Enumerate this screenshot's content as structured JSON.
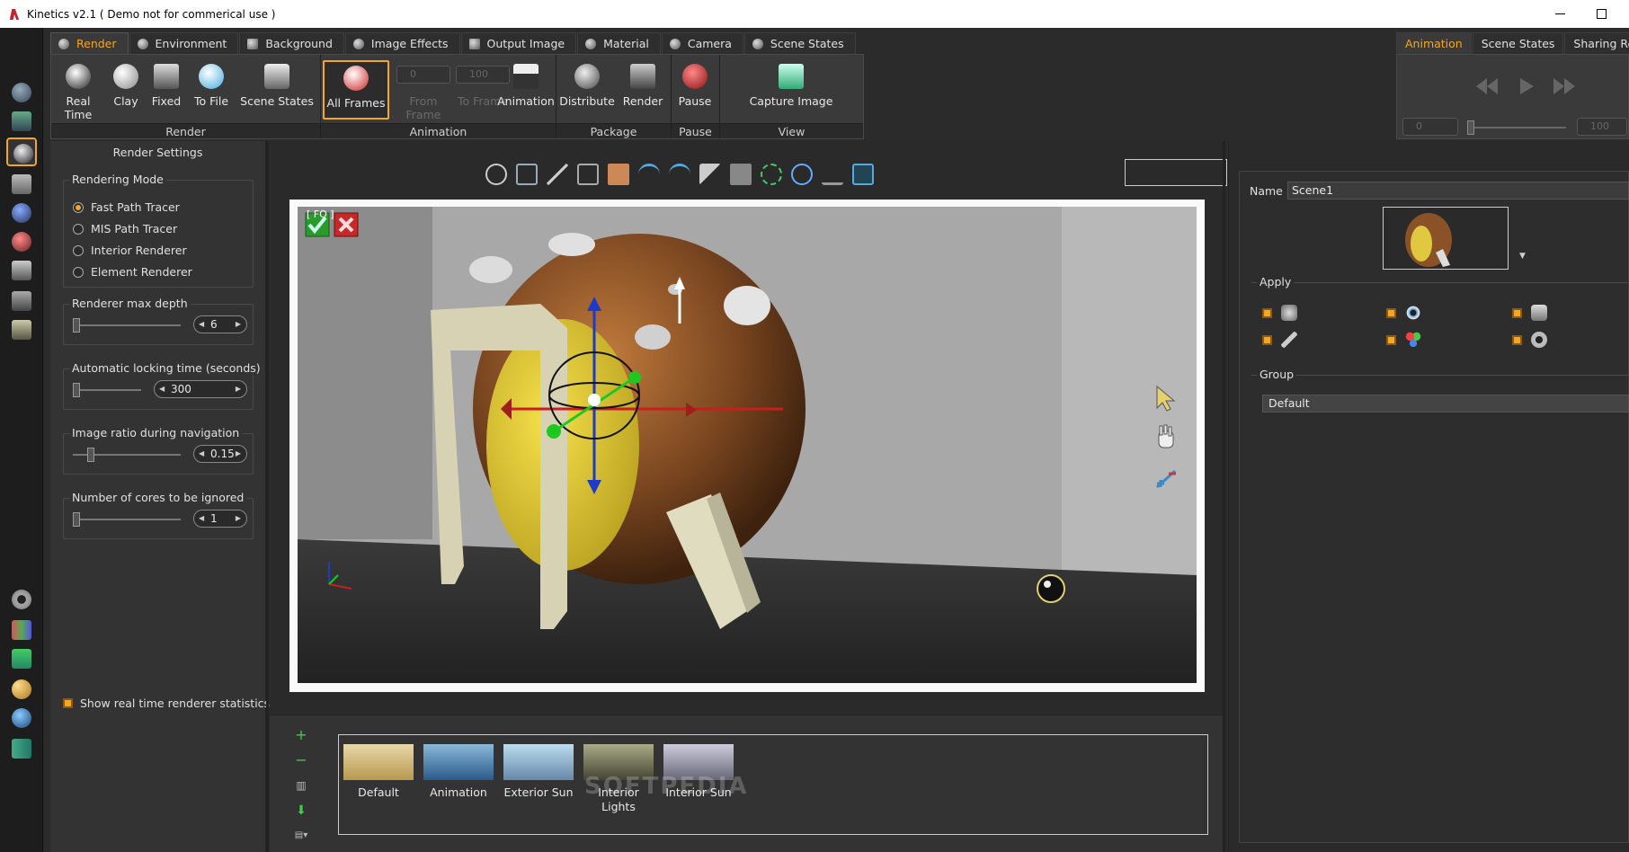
{
  "window": {
    "title": "Kinetics v2.1 ( Demo not for commerical use )"
  },
  "tabs": [
    {
      "label": "Render",
      "active": true
    },
    {
      "label": "Environment"
    },
    {
      "label": "Background"
    },
    {
      "label": "Image Effects"
    },
    {
      "label": "Output Image"
    },
    {
      "label": "Material"
    },
    {
      "label": "Camera"
    },
    {
      "label": "Scene States"
    }
  ],
  "ribbon": {
    "groups": [
      {
        "label": "Render"
      },
      {
        "label": "Animation"
      },
      {
        "label": "Package"
      },
      {
        "label": "Pause"
      },
      {
        "label": "View"
      }
    ],
    "buttons": [
      {
        "label": "Real Time",
        "icon": "camera-ball-icon"
      },
      {
        "label": "Clay",
        "icon": "clay-sphere-icon"
      },
      {
        "label": "Fixed",
        "icon": "fixed-frame-icon"
      },
      {
        "label": "To File",
        "icon": "to-file-icon"
      },
      {
        "label": "Scene States",
        "icon": "scene-states-icon"
      },
      {
        "label": "All Frames",
        "icon": "all-frames-icon",
        "active": true
      },
      {
        "label": "From Frame",
        "value": "0",
        "disabled": true
      },
      {
        "label": "To Frame",
        "value": "100",
        "disabled": true
      },
      {
        "label": "Animation",
        "icon": "clapper-icon"
      },
      {
        "label": "Distribute",
        "icon": "distribute-icon"
      },
      {
        "label": "Render",
        "icon": "render-clapper-icon"
      },
      {
        "label": "Pause",
        "icon": "pause-icon"
      },
      {
        "label": "Capture Image",
        "icon": "capture-image-icon"
      }
    ]
  },
  "right_tabs": [
    {
      "label": "Animation",
      "active": true
    },
    {
      "label": "Scene States"
    },
    {
      "label": "Sharing Reso"
    }
  ],
  "right_ribbon": {
    "frame_value": "0",
    "end_value": "100"
  },
  "render_settings": {
    "title": "Render Settings",
    "rendering_mode": {
      "legend": "Rendering Mode",
      "options": [
        "Fast Path Tracer",
        "MIS Path Tracer",
        "Interior Renderer",
        "Element Renderer"
      ],
      "selected": "Fast Path Tracer"
    },
    "max_depth": {
      "legend": "Renderer max depth",
      "value": "6"
    },
    "locking_time": {
      "legend": "Automatic locking time (seconds)",
      "value": "300"
    },
    "image_ratio": {
      "legend": "Image ratio during navigation",
      "value": "0.15"
    },
    "cores_ignored": {
      "legend": "Number of cores to be ignored",
      "value": "1"
    },
    "show_stats": {
      "label": "Show real time renderer statistics",
      "checked": true
    }
  },
  "viewport": {
    "overlay_label": "[ FO    ]"
  },
  "presets": [
    {
      "label": "Default"
    },
    {
      "label": "Animation"
    },
    {
      "label": "Exterior Sun"
    },
    {
      "label": "Interior Lights"
    },
    {
      "label": "Interior Sun"
    }
  ],
  "watermark": "SOFTPEDIA",
  "scene_panel": {
    "name_label": "Name",
    "name_value": "Scene1",
    "apply_legend": "Apply",
    "group_legend": "Group",
    "group_value": "Default"
  }
}
